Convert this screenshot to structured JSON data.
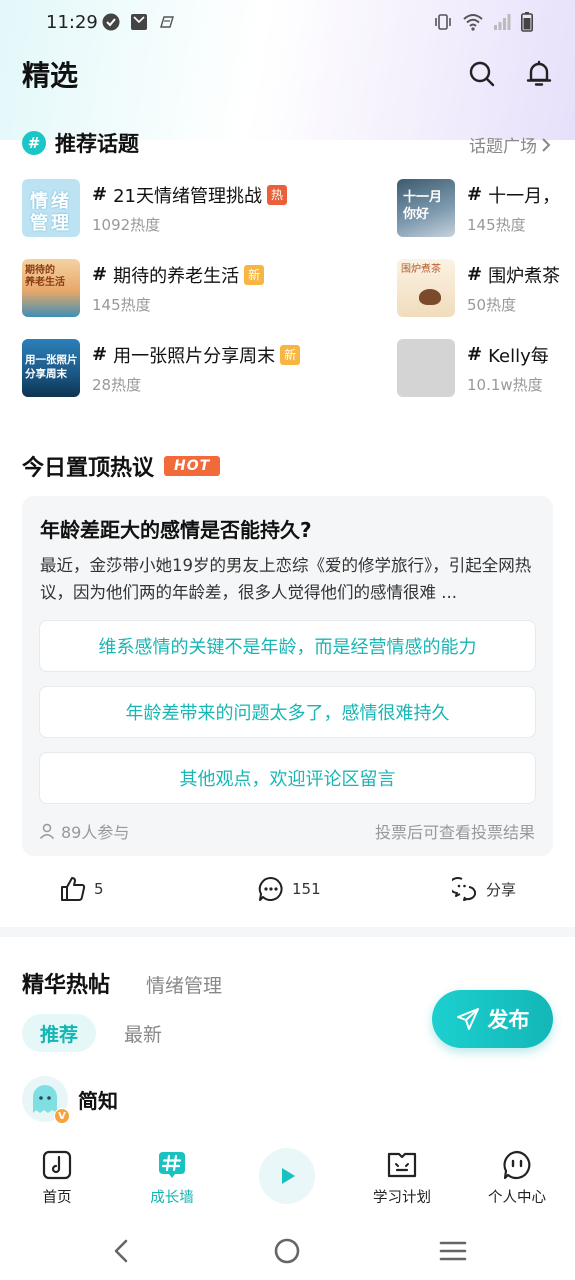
{
  "status": {
    "time": "11:29"
  },
  "header": {
    "title": "精选"
  },
  "topics": {
    "title": "推荐话题",
    "more_label": "话题广场",
    "items": [
      {
        "name": "21天情绪管理挑战",
        "heat": "1092热度",
        "tag": "热",
        "thumb_text": "情绪管理"
      },
      {
        "name": "十一月，",
        "heat": "145热度",
        "tag": "",
        "thumb_text": "十一月 你好"
      },
      {
        "name": "期待的养老生活",
        "heat": "145热度",
        "tag": "新",
        "thumb_text": "期待的养老生活"
      },
      {
        "name": "围炉煮茶",
        "heat": "50热度",
        "tag": "",
        "thumb_text": "围炉煮茶"
      },
      {
        "name": "用一张照片分享周末",
        "heat": "28热度",
        "tag": "新",
        "thumb_text": "用一张照片分享周末"
      },
      {
        "name": "Kelly每",
        "heat": "10.1w热度",
        "tag": "",
        "thumb_text": ""
      }
    ]
  },
  "hot": {
    "title": "今日置顶热议",
    "badge": "HOT",
    "question": "年龄差距大的感情是否能持久?",
    "description": "最近，金莎带小她19岁的男友上恋综《爱的修学旅行》，引起全网热议，因为他们两的年龄差，很多人觉得他们的感情很难 ...",
    "options": [
      "维系感情的关键不是年龄，而是经营情感的能力",
      "年龄差带来的问题太多了，感情很难持久",
      "其他观点，欢迎评论区留言"
    ],
    "participants": "89人参与",
    "result_hint": "投票后可查看投票结果"
  },
  "actions": {
    "likes": "5",
    "comments": "151",
    "share": "分享"
  },
  "feed": {
    "title": "精华热帖",
    "subtitle": "情绪管理",
    "tab_recommend": "推荐",
    "tab_latest": "最新",
    "publish": "发布",
    "author": "简知"
  },
  "tabbar": {
    "home": "首页",
    "growth_wall": "成长墙",
    "study_plan": "学习计划",
    "profile": "个人中心"
  },
  "colors": {
    "accent": "#12b6b4",
    "hot": "#f26a3a",
    "new": "#f7b544"
  }
}
